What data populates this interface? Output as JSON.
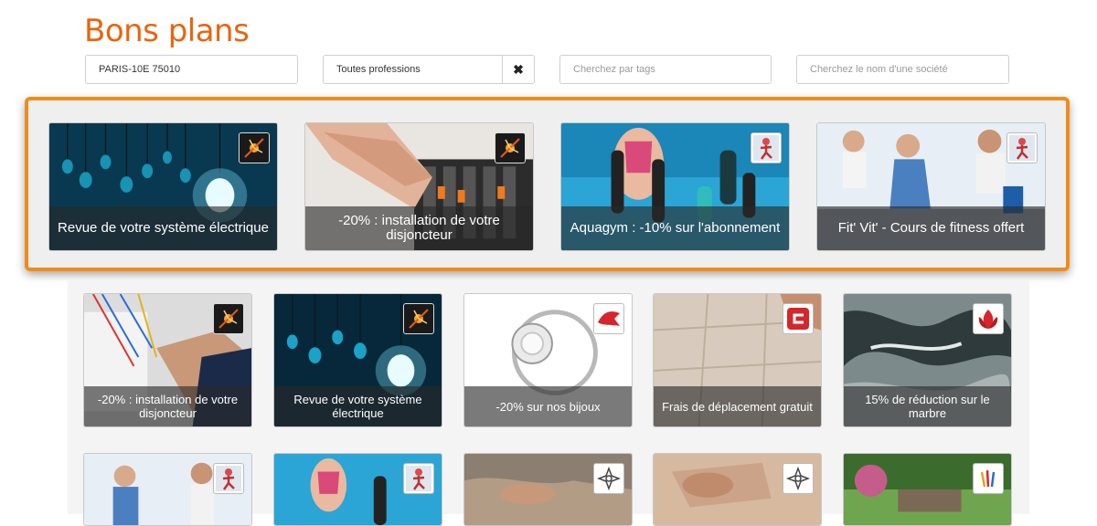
{
  "page": {
    "title": "Bons plans"
  },
  "filters": {
    "location": "PARIS-10E 75010",
    "profession": "Toutes professions",
    "clear_icon": "✖",
    "tags_placeholder": "Cherchez par tags",
    "company_placeholder": "Cherchez le nom d'une société"
  },
  "featured": [
    {
      "caption": "Revue de votre système électrique",
      "icon": "electric-spark-icon"
    },
    {
      "caption": "-20% : installation de votre disjoncteur",
      "icon": "electric-spark-icon"
    },
    {
      "caption": "Aquagym : -10% sur l'abonnement",
      "icon": "fitness-person-icon"
    },
    {
      "caption": "Fit' Vit' - Cours de fitness offert",
      "icon": "fitness-person-icon"
    }
  ],
  "grid": [
    {
      "caption": "-20% : installation de votre disjoncteur",
      "icon": "electric-spark-icon"
    },
    {
      "caption": "Revue de votre système électrique",
      "icon": "electric-spark-icon"
    },
    {
      "caption": "-20% sur nos bijoux",
      "icon": "jeweler-logo-icon"
    },
    {
      "caption": "Frais de déplacement gratuit",
      "icon": "tiler-logo-icon"
    },
    {
      "caption": "15% de réduction sur le marbre",
      "icon": "marble-logo-icon"
    },
    {
      "caption": "",
      "icon": "fitness-person-icon"
    },
    {
      "caption": "",
      "icon": "fitness-person-icon"
    },
    {
      "caption": "",
      "icon": "flower-star-icon"
    },
    {
      "caption": "",
      "icon": "flower-star-icon"
    },
    {
      "caption": "",
      "icon": "garden-logo-icon"
    }
  ],
  "colors": {
    "accent": "#e8650f",
    "highlight_border": "#f08c1a"
  }
}
